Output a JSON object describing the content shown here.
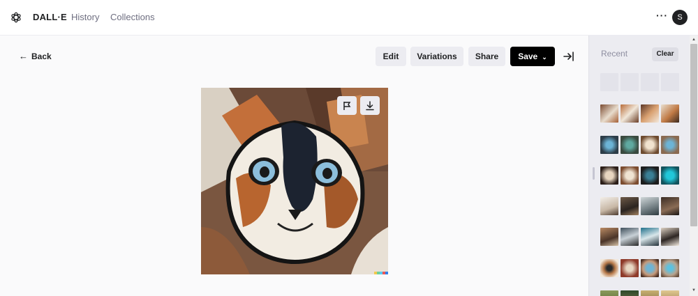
{
  "app": {
    "brand": "DALL·E",
    "nav": [
      {
        "label": "History"
      },
      {
        "label": "Collections"
      }
    ],
    "more_label": "···",
    "avatar_initial": "S"
  },
  "toolbar": {
    "back_label": "Back",
    "edit_label": "Edit",
    "variations_label": "Variations",
    "share_label": "Share",
    "save_label": "Save"
  },
  "image": {
    "subject": "painted cat portrait"
  },
  "sidebar": {
    "recent_label": "Recent",
    "clear_label": "Clear"
  },
  "colors": {
    "accent": "#000000",
    "button_bg": "#ececf1",
    "sidebar_bg": "#ececf1"
  }
}
